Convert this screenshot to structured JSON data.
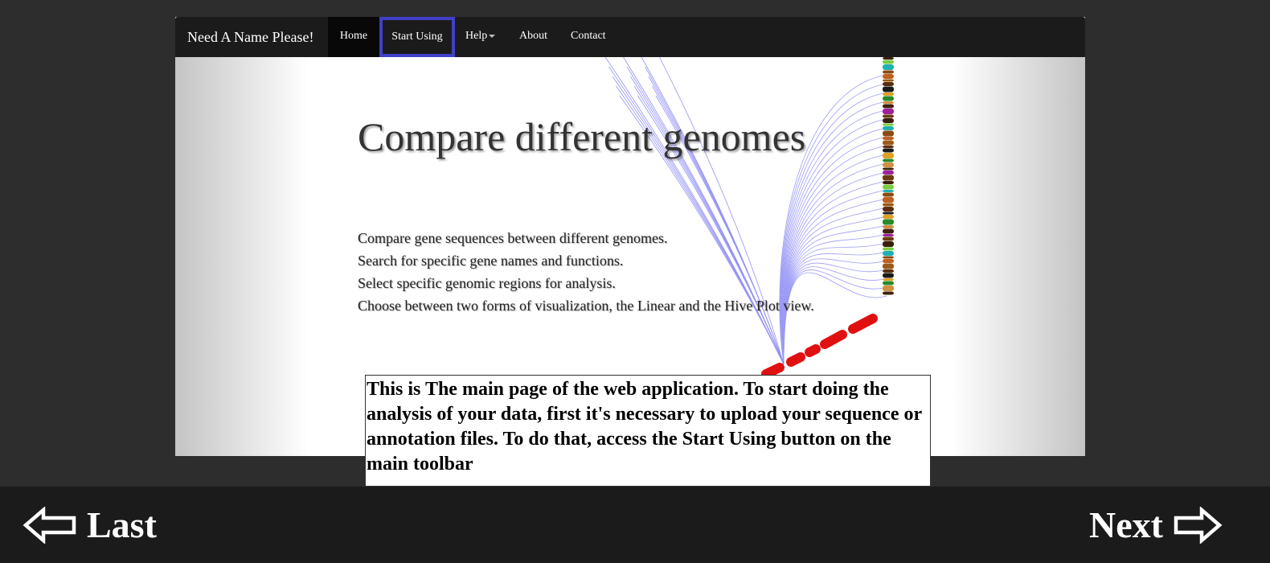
{
  "app": {
    "brand": "Need A Name Please!",
    "nav": {
      "home": "Home",
      "start_using": "Start Using",
      "help": "Help",
      "about": "About",
      "contact": "Contact"
    }
  },
  "hero": {
    "title": "Compare different genomes",
    "features": [
      "Compare gene sequences between different genomes.",
      "Search for specific gene names and functions.",
      "Select specific genomic regions for analysis.",
      "Choose between two forms of visualization, the Linear and the Hive Plot view."
    ]
  },
  "tutorial": {
    "text": "This is The main page of the web application. To start doing the analysis of your data, first it's necessary to upload your sequence or annotation files. To do that, access the Start Using button on the main toolbar"
  },
  "footer": {
    "last_label": "Last",
    "next_label": "Next"
  },
  "colors": {
    "background": "#2d2d2d",
    "navbar": "#1b1b1b",
    "highlight": "#4040c8",
    "hive_link": "#3a3aee",
    "hive_axis_red": "#e01010"
  },
  "icons": {
    "last": "arrow-left-outline-icon",
    "next": "arrow-right-outline-icon",
    "help_dropdown": "caret-down-icon"
  }
}
